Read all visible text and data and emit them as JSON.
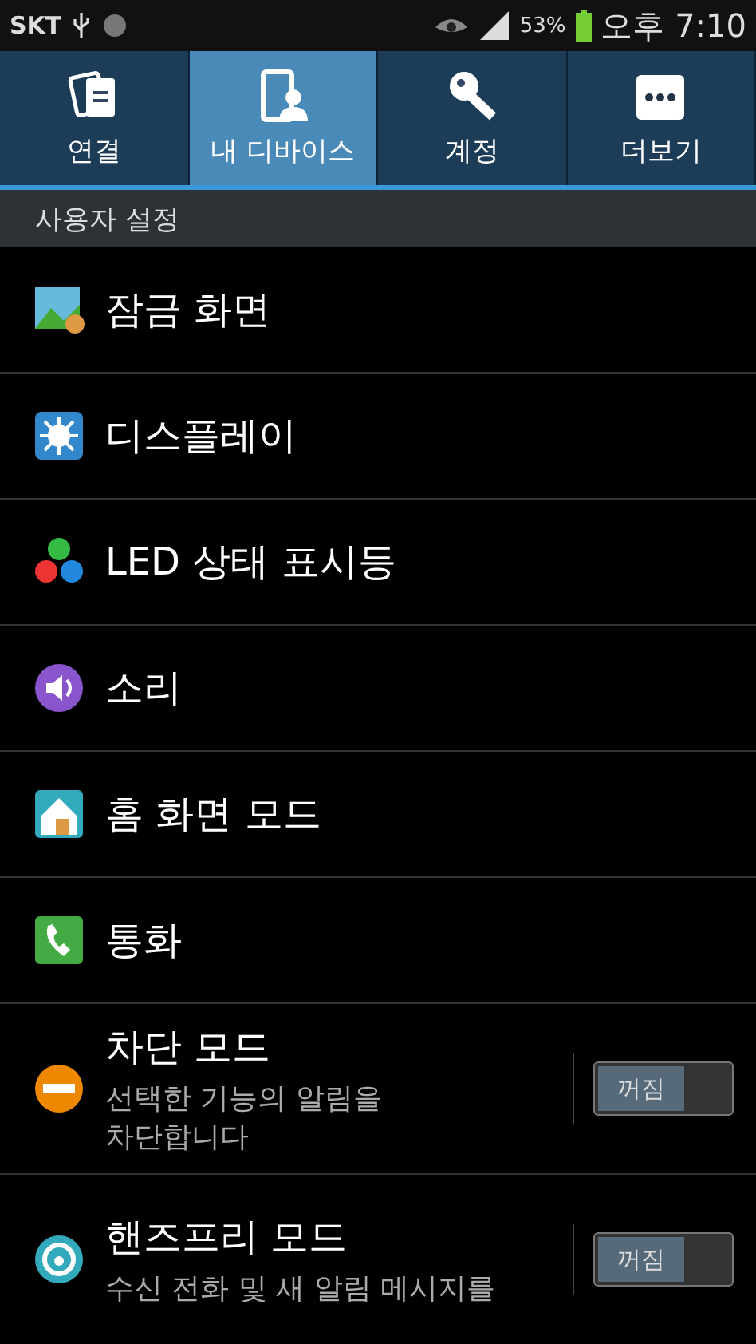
{
  "status_bar": {
    "carrier": "SKT",
    "battery": "53%",
    "time": "오후 7:10"
  },
  "tabs": [
    {
      "label": "연결",
      "selected": false
    },
    {
      "label": "내 디바이스",
      "selected": true
    },
    {
      "label": "계정",
      "selected": false
    },
    {
      "label": "더보기",
      "selected": false
    }
  ],
  "section_header": "사용자 설정",
  "items": [
    {
      "kind": "plain",
      "title": "잠금 화면"
    },
    {
      "kind": "plain",
      "title": "디스플레이"
    },
    {
      "kind": "plain",
      "title": "LED 상태 표시등"
    },
    {
      "kind": "plain",
      "title": "소리"
    },
    {
      "kind": "plain",
      "title": "홈 화면 모드"
    },
    {
      "kind": "plain",
      "title": "통화"
    },
    {
      "kind": "toggle",
      "title": "차단 모드",
      "subtitle": "선택한 기능의 알림을 차단합니다",
      "on": false,
      "toggle_label": "꺼짐"
    },
    {
      "kind": "toggle",
      "title": "핸즈프리 모드",
      "subtitle": "수신 전화 및 새 알림 메시지를",
      "on": false,
      "toggle_label": "꺼짐"
    }
  ]
}
